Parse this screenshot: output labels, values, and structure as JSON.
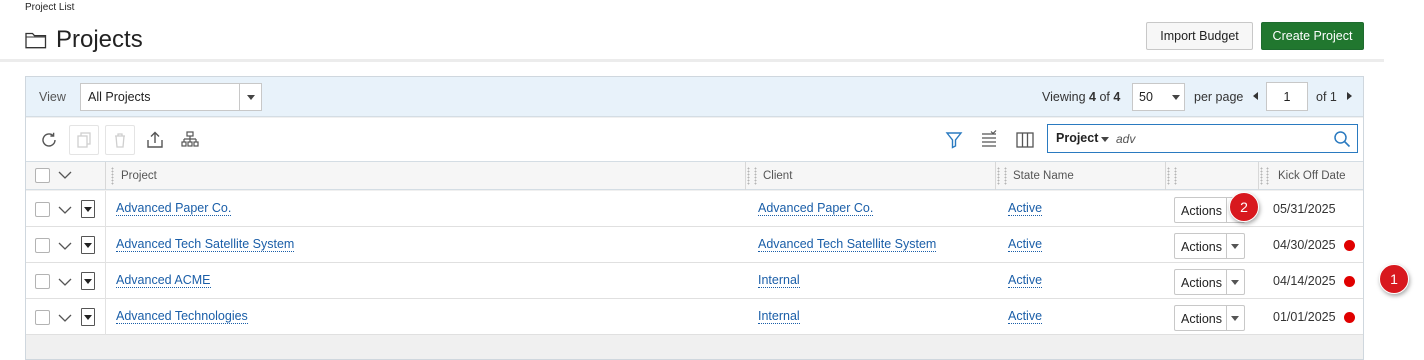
{
  "breadcrumb": "Project List",
  "page_title": "Projects",
  "header_buttons": {
    "import_budget": "Import Budget",
    "create_project": "Create Project"
  },
  "view_bar": {
    "view_label": "View",
    "view_value": "All Projects",
    "viewing_prefix": "Viewing",
    "viewing_count": "4",
    "viewing_of": "of",
    "viewing_total": "4",
    "per_page_value": "50",
    "per_page_label": "per page",
    "page_value": "1",
    "page_of": "of 1"
  },
  "toolbar": {
    "icons": [
      "refresh-icon",
      "copy-icon",
      "delete-icon",
      "export-icon",
      "hierarchy-icon",
      "filter-icon",
      "list-settings-icon",
      "columns-icon"
    ],
    "search_field": "Project",
    "search_value": "adv"
  },
  "columns": {
    "project": "Project",
    "client": "Client",
    "state": "State Name",
    "actions": "",
    "kickoff": "Kick Off Date"
  },
  "rows": [
    {
      "project": "Advanced Paper Co.",
      "client": "Advanced Paper Co.",
      "state": "Active",
      "actions": "Actions",
      "kickoff": "05/31/2025",
      "overdue": false
    },
    {
      "project": "Advanced Tech Satellite System",
      "client": "Advanced Tech Satellite System",
      "state": "Active",
      "actions": "Actions",
      "kickoff": "04/30/2025",
      "overdue": true
    },
    {
      "project": "Advanced ACME",
      "client": "Internal",
      "state": "Active",
      "actions": "Actions",
      "kickoff": "04/14/2025",
      "overdue": true
    },
    {
      "project": "Advanced Technologies",
      "client": "Internal",
      "state": "Active",
      "actions": "Actions",
      "kickoff": "01/01/2025",
      "overdue": true
    }
  ],
  "callouts": [
    "1",
    "2"
  ],
  "colors": {
    "accent_blue": "#1a5ea8",
    "create_green": "#21772f",
    "status_red": "#e00000",
    "callout_red": "#d8181e"
  }
}
